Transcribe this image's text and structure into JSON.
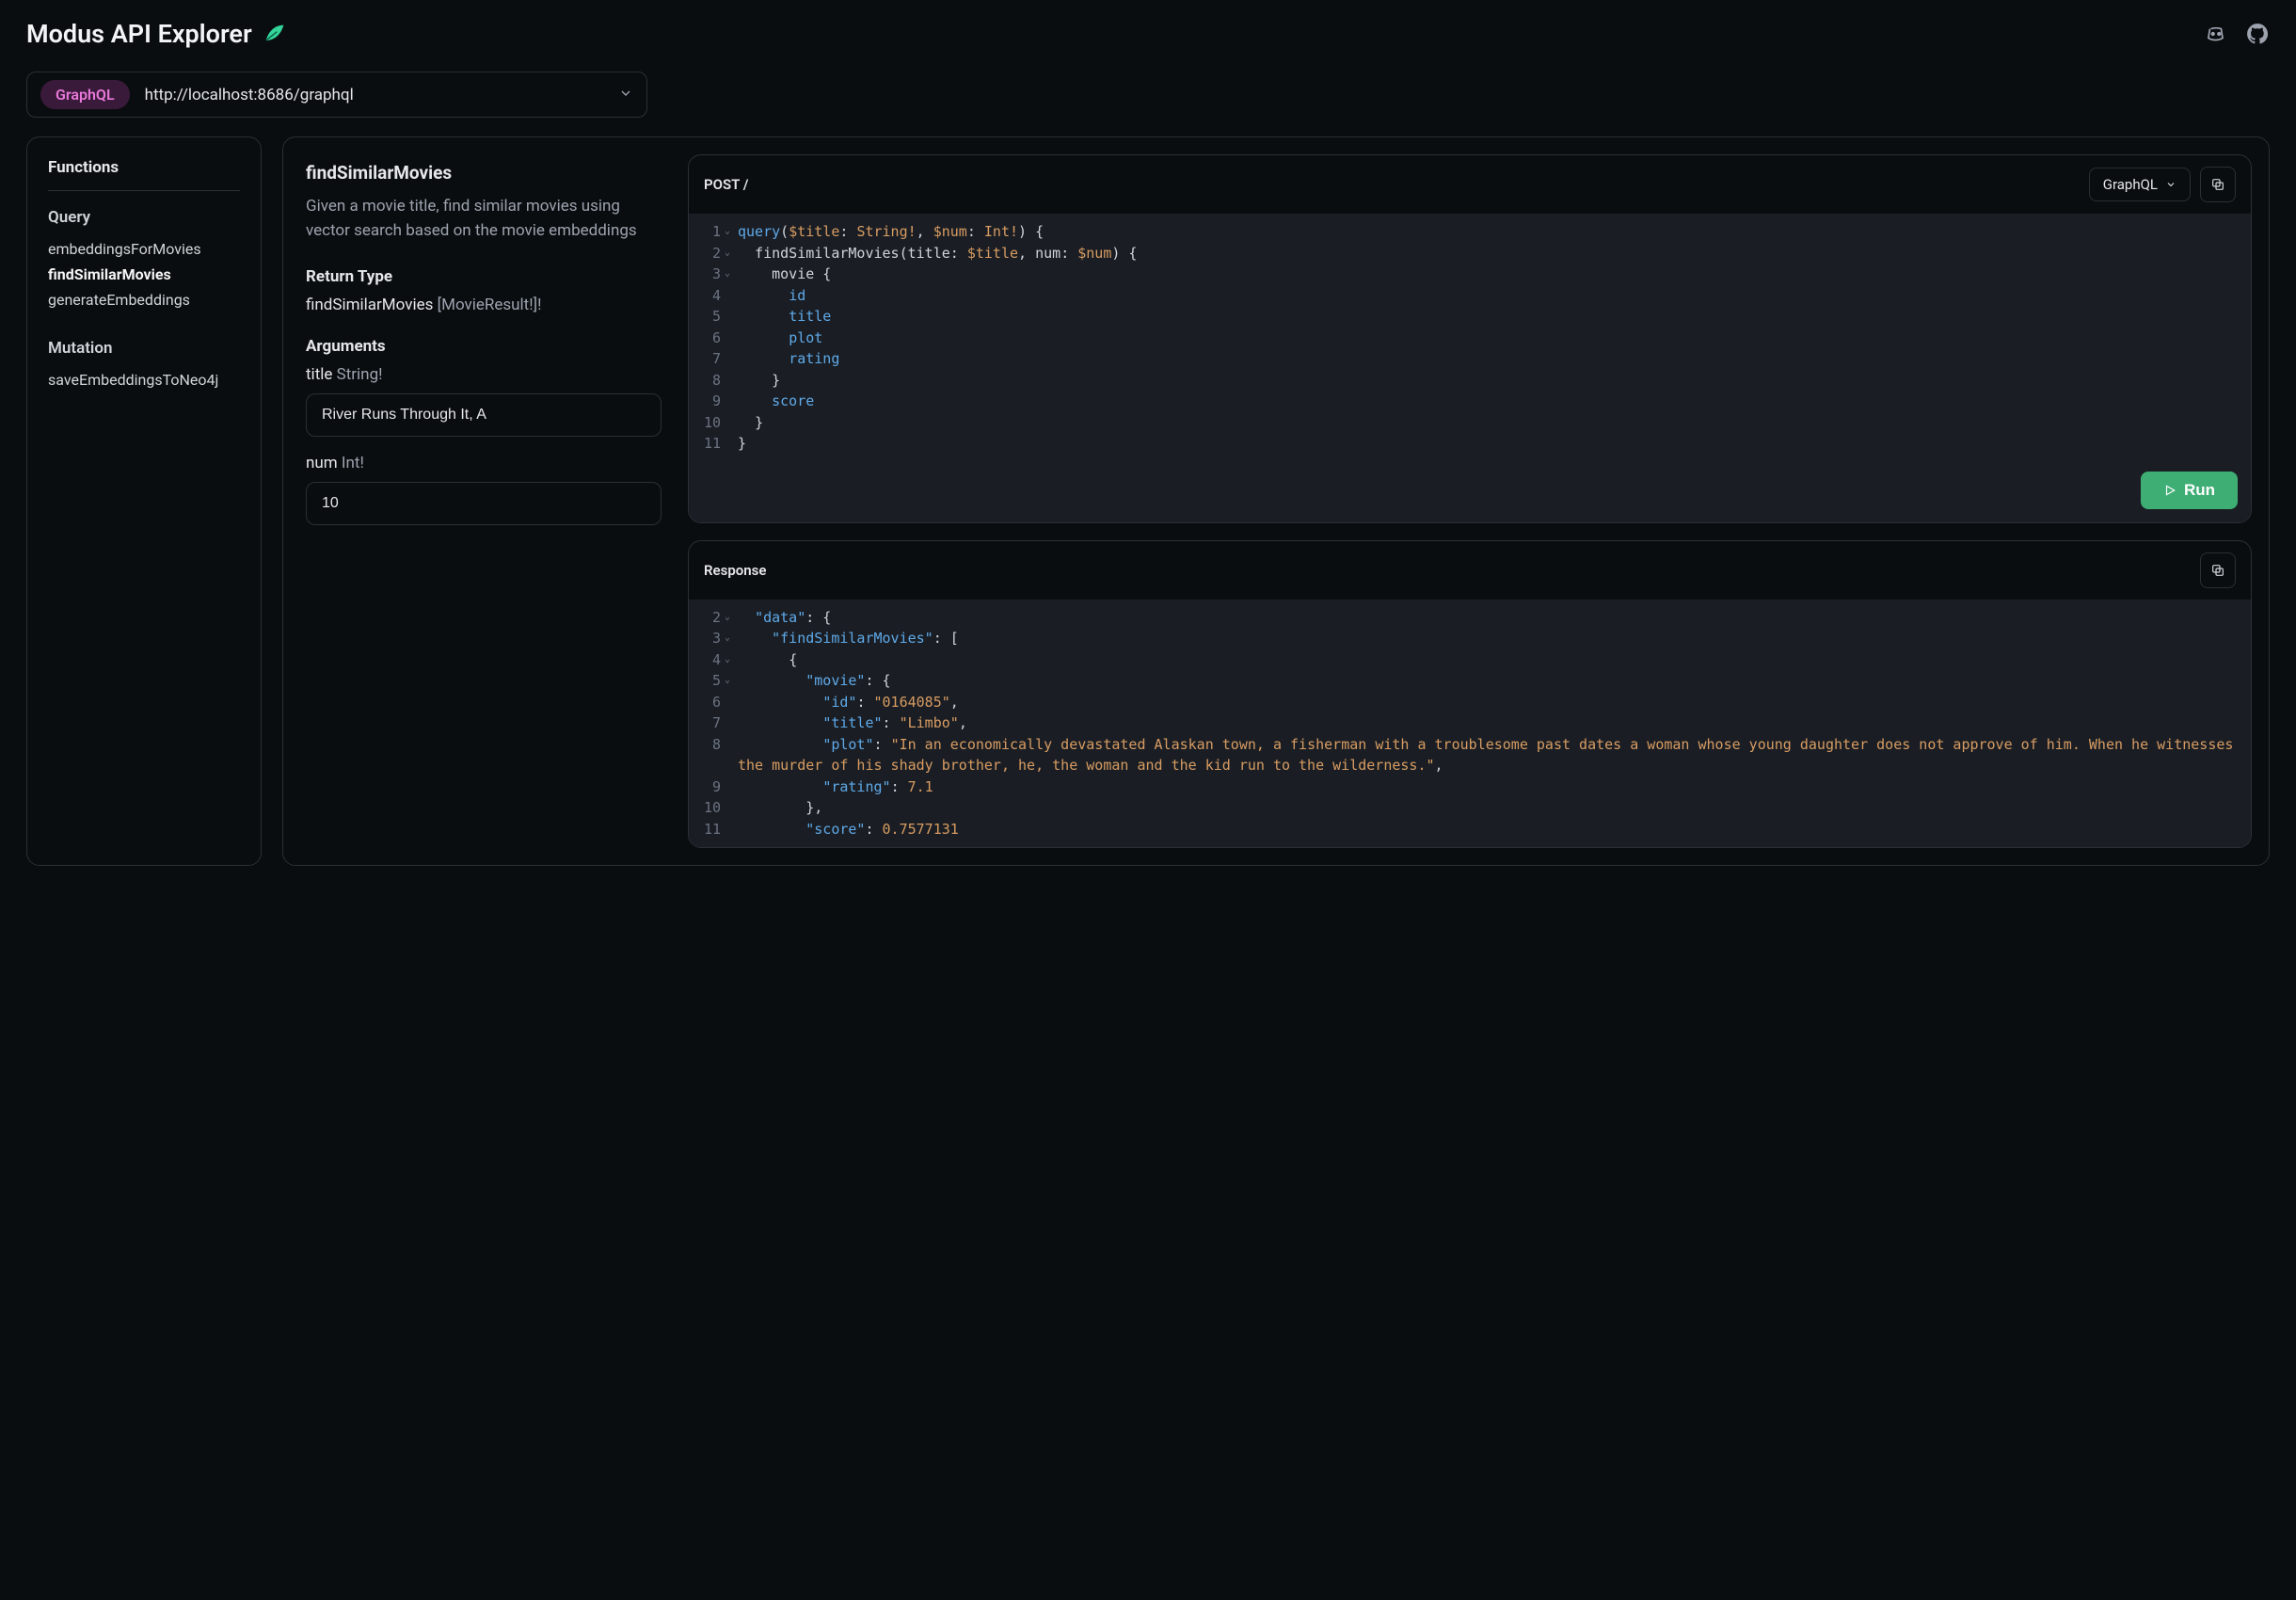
{
  "app": {
    "title": "Modus API Explorer"
  },
  "endpoint": {
    "badge": "GraphQL",
    "url": "http://localhost:8686/graphql"
  },
  "sidebar": {
    "title": "Functions",
    "sections": [
      {
        "label": "Query",
        "items": [
          "embeddingsForMovies",
          "findSimilarMovies",
          "generateEmbeddings"
        ],
        "active": "findSimilarMovies"
      },
      {
        "label": "Mutation",
        "items": [
          "saveEmbeddingsToNeo4j"
        ]
      }
    ]
  },
  "detail": {
    "name": "findSimilarMovies",
    "description": "Given a movie title, find similar movies using vector search based on the movie embeddings",
    "return_label": "Return Type",
    "return_fn": "findSimilarMovies",
    "return_type": "[MovieResult!]!",
    "args_label": "Arguments",
    "args": [
      {
        "name": "title",
        "type": "String!",
        "value": "River Runs Through It, A"
      },
      {
        "name": "num",
        "type": "Int!",
        "value": "10"
      }
    ]
  },
  "request": {
    "method_path": "POST /",
    "lang": "GraphQL",
    "lines": [
      {
        "n": 1,
        "fold": true,
        "tokens": [
          [
            "kw",
            "query"
          ],
          [
            "punc",
            "("
          ],
          [
            "var",
            "$title"
          ],
          [
            "punc",
            ": "
          ],
          [
            "type",
            "String!"
          ],
          [
            "punc",
            ", "
          ],
          [
            "var",
            "$num"
          ],
          [
            "punc",
            ": "
          ],
          [
            "type",
            "Int!"
          ],
          [
            "punc",
            ") {"
          ]
        ]
      },
      {
        "n": 2,
        "fold": true,
        "indent": 1,
        "tokens": [
          [
            "id",
            "findSimilarMovies"
          ],
          [
            "punc",
            "("
          ],
          [
            "id",
            "title"
          ],
          [
            "punc",
            ": "
          ],
          [
            "var",
            "$title"
          ],
          [
            "punc",
            ", "
          ],
          [
            "id",
            "num"
          ],
          [
            "punc",
            ": "
          ],
          [
            "var",
            "$num"
          ],
          [
            "punc",
            ") {"
          ]
        ]
      },
      {
        "n": 3,
        "fold": true,
        "indent": 2,
        "tokens": [
          [
            "id",
            "movie"
          ],
          [
            "punc",
            " {"
          ]
        ]
      },
      {
        "n": 4,
        "indent": 3,
        "tokens": [
          [
            "field",
            "id"
          ]
        ]
      },
      {
        "n": 5,
        "indent": 3,
        "tokens": [
          [
            "field",
            "title"
          ]
        ]
      },
      {
        "n": 6,
        "indent": 3,
        "tokens": [
          [
            "field",
            "plot"
          ]
        ]
      },
      {
        "n": 7,
        "indent": 3,
        "tokens": [
          [
            "field",
            "rating"
          ]
        ]
      },
      {
        "n": 8,
        "indent": 2,
        "tokens": [
          [
            "punc",
            "}"
          ]
        ]
      },
      {
        "n": 9,
        "indent": 2,
        "tokens": [
          [
            "field",
            "score"
          ]
        ]
      },
      {
        "n": 10,
        "indent": 1,
        "tokens": [
          [
            "punc",
            "}"
          ]
        ]
      },
      {
        "n": 11,
        "indent": 0,
        "tokens": [
          [
            "punc",
            "}"
          ]
        ]
      }
    ],
    "run_label": "Run"
  },
  "response": {
    "label": "Response",
    "lines": [
      {
        "n": 2,
        "fold": true,
        "indent": 1,
        "tokens": [
          [
            "key",
            "\"data\""
          ],
          [
            "punc",
            ": {"
          ]
        ]
      },
      {
        "n": 3,
        "fold": true,
        "indent": 2,
        "tokens": [
          [
            "key",
            "\"findSimilarMovies\""
          ],
          [
            "punc",
            ": ["
          ]
        ]
      },
      {
        "n": 4,
        "fold": true,
        "indent": 3,
        "tokens": [
          [
            "punc",
            "{"
          ]
        ]
      },
      {
        "n": 5,
        "fold": true,
        "indent": 4,
        "tokens": [
          [
            "key",
            "\"movie\""
          ],
          [
            "punc",
            ": {"
          ]
        ]
      },
      {
        "n": 6,
        "indent": 5,
        "tokens": [
          [
            "key",
            "\"id\""
          ],
          [
            "punc",
            ": "
          ],
          [
            "str",
            "\"0164085\""
          ],
          [
            "punc",
            ","
          ]
        ]
      },
      {
        "n": 7,
        "indent": 5,
        "tokens": [
          [
            "key",
            "\"title\""
          ],
          [
            "punc",
            ": "
          ],
          [
            "str",
            "\"Limbo\""
          ],
          [
            "punc",
            ","
          ]
        ]
      },
      {
        "n": 8,
        "indent": 5,
        "wrap": true,
        "tokens": [
          [
            "key",
            "\"plot\""
          ],
          [
            "punc",
            ": "
          ],
          [
            "str",
            "\"In an economically devastated Alaskan town, a fisherman with a troublesome past dates a woman whose young daughter does not approve of him. When he witnesses the murder of his shady brother, he, the woman and the kid run to the wilderness.\""
          ],
          [
            "punc",
            ","
          ]
        ]
      },
      {
        "n": 9,
        "indent": 5,
        "tokens": [
          [
            "key",
            "\"rating\""
          ],
          [
            "punc",
            ": "
          ],
          [
            "num",
            "7.1"
          ]
        ]
      },
      {
        "n": 10,
        "indent": 4,
        "tokens": [
          [
            "punc",
            "},"
          ]
        ]
      },
      {
        "n": 11,
        "indent": 4,
        "tokens": [
          [
            "key",
            "\"score\""
          ],
          [
            "punc",
            ": "
          ],
          [
            "num",
            "0.7577131"
          ]
        ]
      }
    ]
  }
}
